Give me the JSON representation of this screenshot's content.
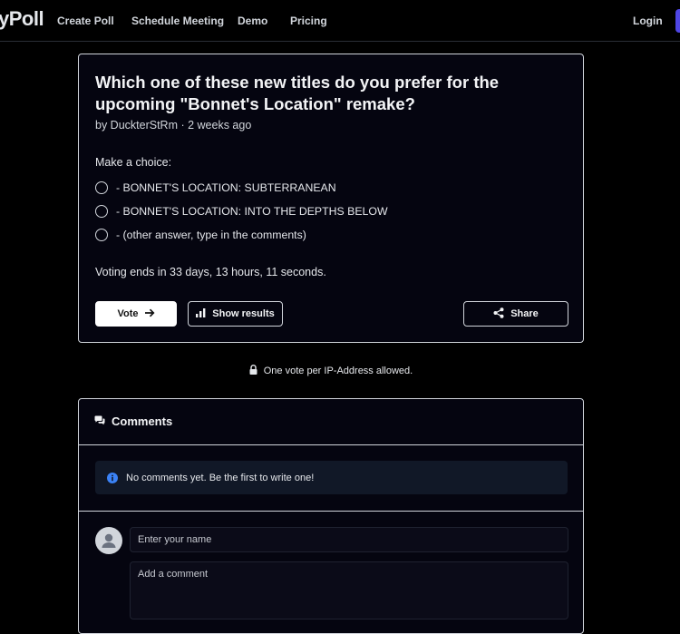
{
  "header": {
    "logo": "yPoll",
    "nav": [
      "Create Poll",
      "Schedule Meeting",
      "Demo",
      "Pricing"
    ],
    "login": "Login"
  },
  "poll": {
    "title": "Which one of these new titles do you prefer for the upcoming \"Bonnet's Location\" remake?",
    "byline": "by DuckterStRm · 2 weeks ago",
    "prompt": "Make a choice:",
    "options": [
      "- BONNET'S LOCATION: SUBTERRANEAN",
      "- BONNET'S LOCATION: INTO THE DEPTHS BELOW",
      "- (other answer, type in the comments)"
    ],
    "voting_ends": "Voting ends in 33 days, 13 hours, 11 seconds.",
    "vote_label": "Vote",
    "results_label": "Show results",
    "share_label": "Share"
  },
  "ip_note": "One vote per IP-Address allowed.",
  "comments": {
    "title": "Comments",
    "empty_message": "No comments yet. Be the first to write one!",
    "name_placeholder": "Enter your name",
    "comment_placeholder": "Add a comment"
  },
  "colors": {
    "background": "#000000",
    "card_border": "#d1d5db",
    "info_icon": "#3b82f6",
    "signup_accent": "#4f46e5"
  }
}
